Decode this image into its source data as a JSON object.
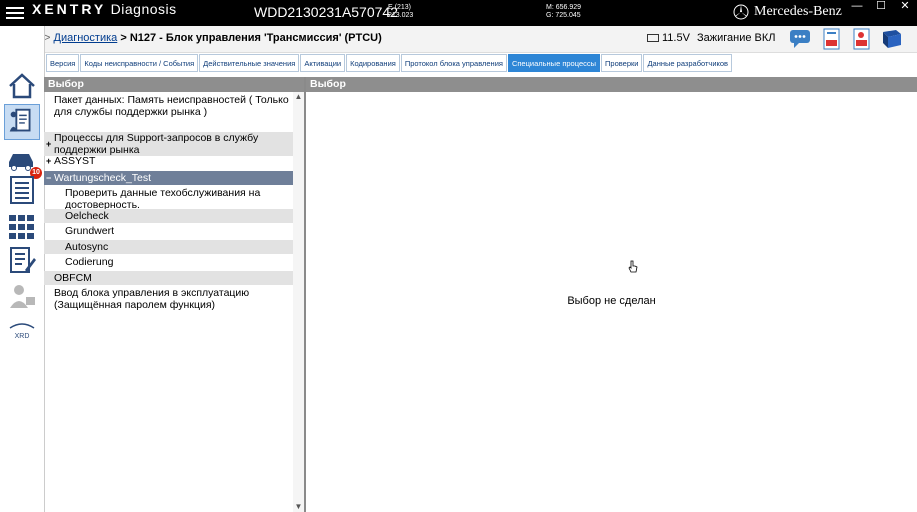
{
  "titlebar": {
    "app_brand": "XENTRY",
    "app_name": "Diagnosis",
    "vin": "WDD2130231A570742",
    "e_line1": "E (213)",
    "e_line2": "213.023",
    "m_line1": "M: 656.929",
    "m_line2": "G: 725.045",
    "brand": "Mercedes-Benz",
    "minimize": "—",
    "maximize": "☐",
    "close": "✕"
  },
  "breadcrumb": {
    "sep": ">",
    "link": "Диагностика",
    "current": "> N127 - Блок управления 'Трансмиссия' (PTCU)"
  },
  "status": {
    "voltage": "11.5V",
    "ignition": "Зажигание ВКЛ"
  },
  "sidebar": {
    "badge": "10"
  },
  "tabs": [
    {
      "label": "Версия"
    },
    {
      "label": "Коды неисправности / События"
    },
    {
      "label": "Действительные значения"
    },
    {
      "label": "Активации"
    },
    {
      "label": "Кодирования"
    },
    {
      "label": "Протокол блока управления"
    },
    {
      "label": "Специальные процессы"
    },
    {
      "label": "Проверки"
    },
    {
      "label": "Данные разработчиков"
    }
  ],
  "left_panel": {
    "header": "Выбор",
    "items": [
      {
        "line1": "Пакет данных: Память неисправностей ( Только",
        "line2": "для службы поддержки рынка )"
      },
      {
        "line1": "Процессы для Support-запросов в службу",
        "line2": "поддержки рынка",
        "toggle": "+"
      },
      {
        "line1": "ASSYST",
        "toggle": "+"
      },
      {
        "line1": "Wartungscheck_Test",
        "toggle": "−"
      },
      {
        "line1": "Проверить данные техобслуживания на",
        "line2": "достоверность."
      },
      {
        "line1": "Oelcheck"
      },
      {
        "line1": "Grundwert"
      },
      {
        "line1": "Autosync"
      },
      {
        "line1": "Codierung"
      },
      {
        "line1": "OBFCM"
      },
      {
        "line1": "Ввод блока управления в эксплуатацию",
        "line2": "(Защищённая паролем функция)"
      }
    ]
  },
  "right_panel": {
    "header": "Выбор",
    "empty_message": "Выбор не сделан"
  },
  "colors": {
    "titlebar": "#000000",
    "active_tab": "#2e86d6",
    "selected_row": "#6f7f99",
    "panel_header": "#8e8e8e"
  }
}
